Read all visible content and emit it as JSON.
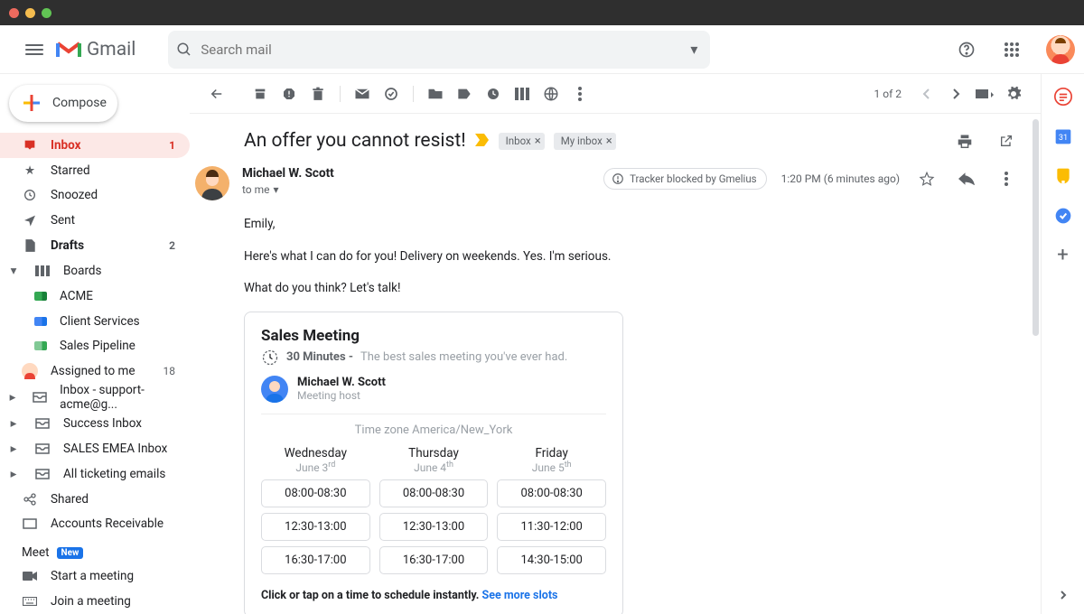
{
  "app": {
    "name": "Gmail"
  },
  "search": {
    "placeholder": "Search mail"
  },
  "compose_label": "Compose",
  "sidebar": {
    "primary": [
      {
        "label": "Inbox",
        "count": "1"
      },
      {
        "label": "Starred"
      },
      {
        "label": "Snoozed"
      },
      {
        "label": "Sent"
      },
      {
        "label": "Drafts",
        "count": "2"
      },
      {
        "label": "Boards"
      }
    ],
    "boards": [
      {
        "label": "ACME"
      },
      {
        "label": "Client Services"
      },
      {
        "label": "Sales Pipeline"
      }
    ],
    "more": [
      {
        "label": "Assigned to me",
        "count": "18"
      },
      {
        "label": "Inbox - support-acme@g..."
      },
      {
        "label": "Success Inbox"
      },
      {
        "label": "SALES EMEA Inbox"
      },
      {
        "label": "All ticketing emails"
      },
      {
        "label": "Shared"
      },
      {
        "label": "Accounts Receivable"
      }
    ],
    "meet": {
      "header": "Meet",
      "badge": "New",
      "start": "Start a meeting",
      "join": "Join a meeting"
    }
  },
  "toolbar": {
    "position": "1 of 2"
  },
  "email": {
    "subject": "An offer you cannot resist!",
    "labels": [
      "Inbox",
      "My inbox"
    ],
    "sender": "Michael W. Scott",
    "to_line": "to me",
    "tracker_chip": "Tracker blocked by Gmelius",
    "time": "1:20 PM (6 minutes ago)",
    "body": {
      "p1": "Emily,",
      "p2": "Here's what I can do for you! Delivery on weekends. Yes. I'm serious.",
      "p3": "What do you think? Let's talk!"
    }
  },
  "meeting": {
    "title": "Sales Meeting",
    "duration": "30 Minutes -",
    "desc": "The best sales meeting you've ever had.",
    "host_name": "Michael W. Scott",
    "host_role": "Meeting host",
    "timezone": "Time zone America/New_York",
    "days": [
      {
        "name": "Wednesday",
        "date_pre": "June 3",
        "ord": "rd",
        "slots": [
          "08:00-08:30",
          "12:30-13:00",
          "16:30-17:00"
        ]
      },
      {
        "name": "Thursday",
        "date_pre": "June 4",
        "ord": "th",
        "slots": [
          "08:00-08:30",
          "12:30-13:00",
          "16:30-17:00"
        ]
      },
      {
        "name": "Friday",
        "date_pre": "June 5",
        "ord": "th",
        "slots": [
          "08:00-08:30",
          "11:30-12:00",
          "14:30-15:00"
        ]
      }
    ],
    "footer_bold": "Click or tap on a time to schedule instantly.",
    "footer_link": "See more slots"
  }
}
